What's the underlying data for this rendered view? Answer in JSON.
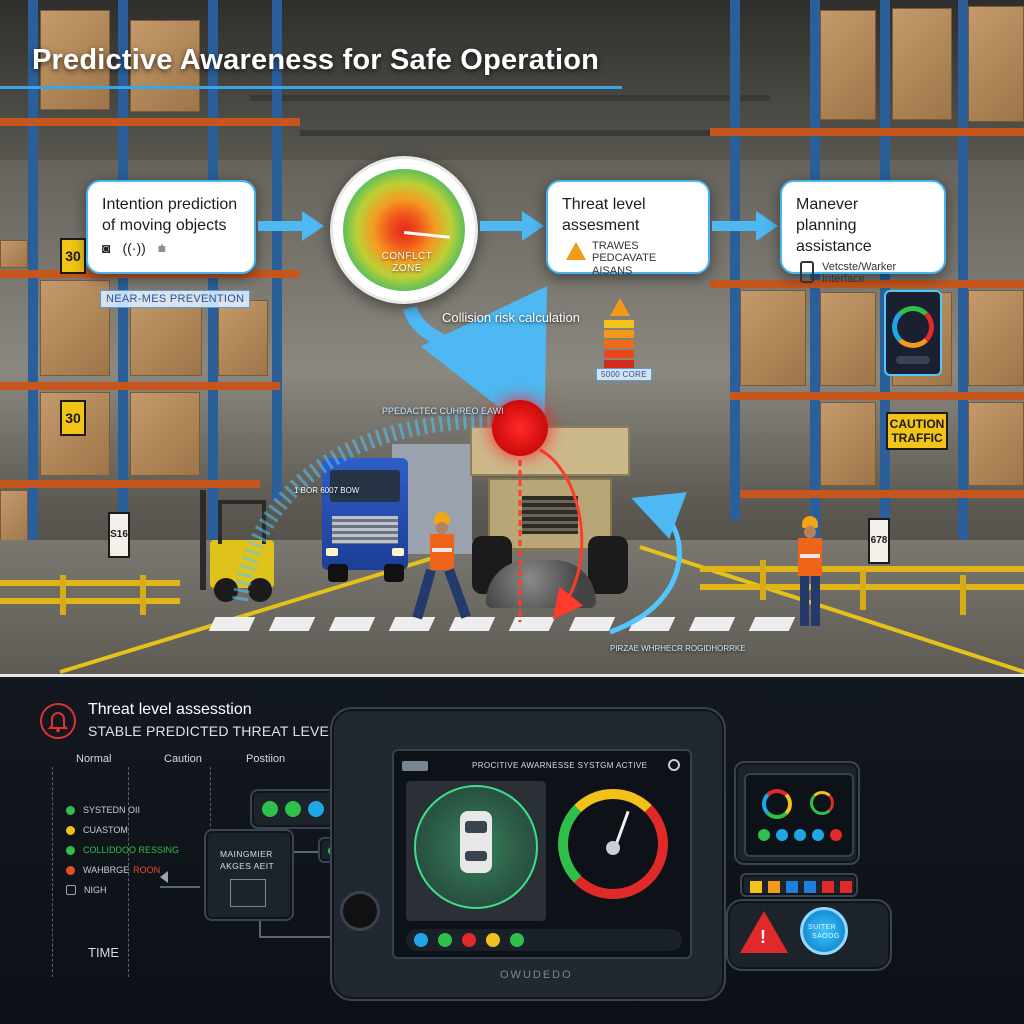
{
  "header": {
    "title": "Predictive Awareness for Safe Operation"
  },
  "flow": {
    "intention_card": {
      "title_line1": "Intention prediction",
      "title_line2": "of moving objects"
    },
    "conflict_gauge": {
      "label_line1": "CONFLCT",
      "label_line2": "ZONE"
    },
    "threat_card": {
      "title_line1": "Threat level",
      "title_line2": "assesment",
      "sub_line1": "TRAWES",
      "sub_line2": "PEDCAVATE AISANS"
    },
    "maneuver_card": {
      "title_line1": "Manever",
      "title_line2": "planning assistance",
      "sub_line1": "Vetcste/Warker",
      "sub_line2": "Interface"
    }
  },
  "scene": {
    "near_miss_tag": "NEAR-MES PREVENTION",
    "collision_risk_label": "Collision risk calculation",
    "risk_badge": "5000 CORE",
    "predicted_path_label": "PPEDACTEC CUHREO EAWI",
    "blue_truck_label": "1 BOR 6007 BOW",
    "bottom_path_label": "PIRZAE WHRHECR ROGIDHORRKE",
    "shelf_sign_1": "30",
    "shelf_sign_2": "30",
    "post_sign_left": "S16",
    "post_sign_right": "678",
    "caution_sign_line1": "CAUTION",
    "caution_sign_line2": "TRAFFIC"
  },
  "panel": {
    "title": "Threat level assesstion",
    "subtitle": "STABLE PREDICTED THREAT LEVEL",
    "columns": [
      "Normal",
      "Caution",
      "Postiion"
    ],
    "legend": [
      {
        "label": "SYSTEDN OII",
        "color": "#2fbf4a"
      },
      {
        "label": "CUASTOM",
        "color": "#f2c21a"
      },
      {
        "label": "COLLIDDOO RESSING",
        "color": "#2fbf4a"
      },
      {
        "label": "WAHBRGE",
        "alert": "ROON",
        "color": "#e8502a"
      },
      {
        "label": "NIGH",
        "color": "#9aa4b0"
      }
    ],
    "time_label": "TIME",
    "side_box": {
      "line1": "MAINGMIER",
      "line2": "AKGES AEIT"
    },
    "screen_header": "PROCITIVE AWARNESSE SYSTGM ACTIVE",
    "bezel_label": "OWUDEDO",
    "button_label": {
      "line1": "SUITER",
      "line2": "SAOOG"
    },
    "lamp_colors": [
      "#2fbf4a",
      "#2fbf4a",
      "#1fa6e8",
      "#f2c21a",
      "#e02a2a"
    ],
    "square_lamp_colors": [
      "#f2c21a",
      "#f29a1a",
      "#1f7ee0",
      "#1f7ee0",
      "#e02a2a",
      "#e02a2a"
    ]
  }
}
